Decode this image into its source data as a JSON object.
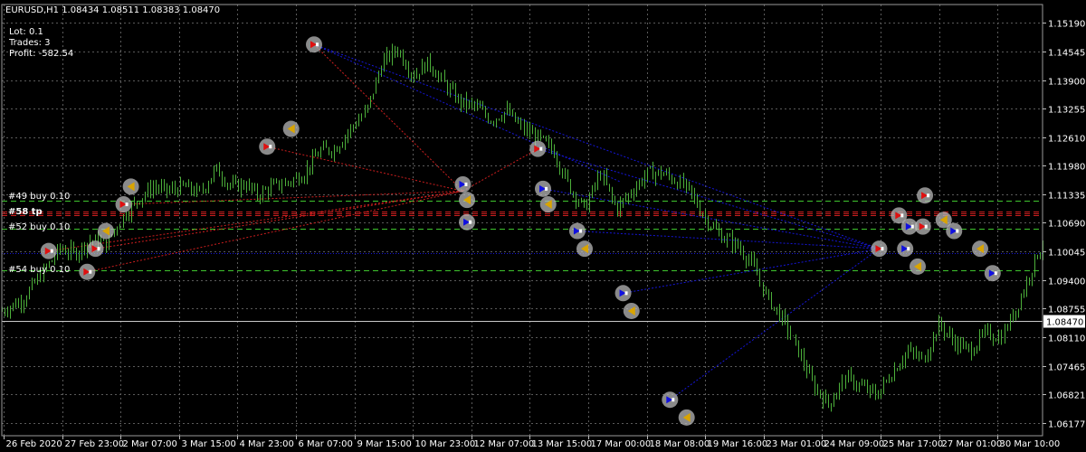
{
  "header": {
    "symbol_line": "EURUSD,H1  1.08434 1.08511 1.08383 1.08470",
    "lot": "Lot: 0.1",
    "trades": "Trades: 3",
    "profit": "Profit: -582.54"
  },
  "current_price": {
    "value": 1.0847,
    "label": "1.08470"
  },
  "colors": {
    "background": "#000000",
    "grid": "#5a5a5a",
    "candle": "#4caf3a",
    "level_green": "#3ec42e",
    "level_red": "#d62020",
    "blue_line": "#1515d8",
    "red_line": "#cc1e1e",
    "price_line": "#c8c8c8"
  },
  "chart_data": {
    "type": "candlestick",
    "title": "EURUSD,H1",
    "ylim": [
      1.0589,
      1.156
    ],
    "y_ticks": [
      {
        "v": 1.1519,
        "label": "1.15190"
      },
      {
        "v": 1.14545,
        "label": "1.14545"
      },
      {
        "v": 1.139,
        "label": "1.13900"
      },
      {
        "v": 1.13255,
        "label": "1.13255"
      },
      {
        "v": 1.1261,
        "label": "1.12610"
      },
      {
        "v": 1.1198,
        "label": "1.11980"
      },
      {
        "v": 1.11335,
        "label": "1.11335"
      },
      {
        "v": 1.1069,
        "label": "1.10690"
      },
      {
        "v": 1.10045,
        "label": "1.10045"
      },
      {
        "v": 1.094,
        "label": "1.09400"
      },
      {
        "v": 1.08755,
        "label": "1.08755"
      },
      {
        "v": 1.0811,
        "label": "1.08110"
      },
      {
        "v": 1.07465,
        "label": "1.07465"
      },
      {
        "v": 1.06821,
        "label": "1.06821"
      },
      {
        "v": 1.06177,
        "label": "1.06177"
      }
    ],
    "x_ticks": [
      "26 Feb 2020",
      "27 Feb 23:00",
      "2 Mar 07:00",
      "3 Mar 15:00",
      "4 Mar 23:00",
      "6 Mar 07:00",
      "9 Mar 15:00",
      "10 Mar 23:00",
      "12 Mar 07:00",
      "13 Mar 15:00",
      "17 Mar 00:00",
      "18 Mar 08:00",
      "19 Mar 16:00",
      "23 Mar 01:00",
      "24 Mar 09:00",
      "25 Mar 17:00",
      "27 Mar 01:00",
      "30 Mar 10:00"
    ],
    "price_path": [
      [
        0,
        1.087
      ],
      [
        0.02,
        1.0895
      ],
      [
        0.04,
        1.096
      ],
      [
        0.055,
        1.101
      ],
      [
        0.07,
        1.1
      ],
      [
        0.085,
        1.103
      ],
      [
        0.1,
        1.102
      ],
      [
        0.115,
        1.108
      ],
      [
        0.13,
        1.112
      ],
      [
        0.145,
        1.115
      ],
      [
        0.16,
        1.114
      ],
      [
        0.175,
        1.115
      ],
      [
        0.19,
        1.1135
      ],
      [
        0.205,
        1.119
      ],
      [
        0.22,
        1.115
      ],
      [
        0.235,
        1.1155
      ],
      [
        0.245,
        1.113
      ],
      [
        0.26,
        1.115
      ],
      [
        0.275,
        1.116
      ],
      [
        0.29,
        1.118
      ],
      [
        0.305,
        1.123
      ],
      [
        0.32,
        1.1235
      ],
      [
        0.335,
        1.128
      ],
      [
        0.35,
        1.132
      ],
      [
        0.365,
        1.143
      ],
      [
        0.38,
        1.146
      ],
      [
        0.395,
        1.14
      ],
      [
        0.41,
        1.143
      ],
      [
        0.425,
        1.138
      ],
      [
        0.44,
        1.134
      ],
      [
        0.455,
        1.133
      ],
      [
        0.47,
        1.13
      ],
      [
        0.485,
        1.132
      ],
      [
        0.5,
        1.128
      ],
      [
        0.515,
        1.126
      ],
      [
        0.53,
        1.123
      ],
      [
        0.545,
        1.115
      ],
      [
        0.56,
        1.11
      ],
      [
        0.575,
        1.118
      ],
      [
        0.59,
        1.11
      ],
      [
        0.605,
        1.114
      ],
      [
        0.62,
        1.118
      ],
      [
        0.635,
        1.118
      ],
      [
        0.65,
        1.116
      ],
      [
        0.66,
        1.114
      ],
      [
        0.675,
        1.108
      ],
      [
        0.69,
        1.104
      ],
      [
        0.705,
        1.102
      ],
      [
        0.72,
        1.098
      ],
      [
        0.735,
        1.09
      ],
      [
        0.75,
        1.085
      ],
      [
        0.765,
        1.078
      ],
      [
        0.78,
        1.07
      ],
      [
        0.795,
        1.066
      ],
      [
        0.81,
        1.072
      ],
      [
        0.825,
        1.07
      ],
      [
        0.84,
        1.068
      ],
      [
        0.855,
        1.073
      ],
      [
        0.87,
        1.078
      ],
      [
        0.885,
        1.076
      ],
      [
        0.9,
        1.084
      ],
      [
        0.915,
        1.08
      ],
      [
        0.93,
        1.078
      ],
      [
        0.945,
        1.082
      ],
      [
        0.96,
        1.081
      ],
      [
        0.975,
        1.088
      ],
      [
        0.985,
        1.094
      ],
      [
        0.995,
        1.1
      ],
      [
        1.0,
        1.102
      ]
    ],
    "levels": [
      {
        "price": 1.1119,
        "color": "green",
        "label": "#49 buy 0.10"
      },
      {
        "price": 1.1094,
        "color": "red",
        "label": ""
      },
      {
        "price": 1.109,
        "color": "red",
        "label": "#58 tp"
      },
      {
        "price": 1.1086,
        "color": "red",
        "label": ""
      },
      {
        "price": 1.1056,
        "color": "green",
        "label": "#52 buy 0.10"
      },
      {
        "price": 1.1,
        "color": "blue",
        "label": ""
      },
      {
        "price": 1.0962,
        "color": "green",
        "label": "#54 buy 0.10"
      }
    ],
    "markers": [
      {
        "x": 0.045,
        "y": 1.1005,
        "c": "red"
      },
      {
        "x": 0.09,
        "y": 1.101,
        "c": "red"
      },
      {
        "x": 0.082,
        "y": 1.0958,
        "c": "red"
      },
      {
        "x": 0.1,
        "y": 1.105,
        "c": "gold"
      },
      {
        "x": 0.117,
        "y": 1.111,
        "c": "red"
      },
      {
        "x": 0.124,
        "y": 1.115,
        "c": "gold"
      },
      {
        "x": 0.255,
        "y": 1.124,
        "c": "red"
      },
      {
        "x": 0.278,
        "y": 1.128,
        "c": "gold"
      },
      {
        "x": 0.3,
        "y": 1.147,
        "c": "red"
      },
      {
        "x": 0.443,
        "y": 1.1155,
        "c": "blue"
      },
      {
        "x": 0.447,
        "y": 1.112,
        "c": "gold"
      },
      {
        "x": 0.447,
        "y": 1.107,
        "c": "blue"
      },
      {
        "x": 0.515,
        "y": 1.1235,
        "c": "red"
      },
      {
        "x": 0.52,
        "y": 1.1145,
        "c": "blue"
      },
      {
        "x": 0.525,
        "y": 1.111,
        "c": "gold"
      },
      {
        "x": 0.553,
        "y": 1.105,
        "c": "blue"
      },
      {
        "x": 0.56,
        "y": 1.101,
        "c": "gold"
      },
      {
        "x": 0.597,
        "y": 1.091,
        "c": "blue"
      },
      {
        "x": 0.605,
        "y": 1.087,
        "c": "gold"
      },
      {
        "x": 0.642,
        "y": 1.067,
        "c": "blue"
      },
      {
        "x": 0.658,
        "y": 1.063,
        "c": "gold"
      },
      {
        "x": 0.843,
        "y": 1.101,
        "c": "red"
      },
      {
        "x": 0.862,
        "y": 1.1085,
        "c": "red"
      },
      {
        "x": 0.868,
        "y": 1.101,
        "c": "blue"
      },
      {
        "x": 0.872,
        "y": 1.106,
        "c": "blue"
      },
      {
        "x": 0.88,
        "y": 1.097,
        "c": "gold"
      },
      {
        "x": 0.885,
        "y": 1.106,
        "c": "red"
      },
      {
        "x": 0.887,
        "y": 1.113,
        "c": "red"
      },
      {
        "x": 0.905,
        "y": 1.1075,
        "c": "gold"
      },
      {
        "x": 0.915,
        "y": 1.105,
        "c": "blue"
      },
      {
        "x": 0.94,
        "y": 1.101,
        "c": "gold"
      },
      {
        "x": 0.952,
        "y": 1.0955,
        "c": "blue"
      }
    ],
    "red_lines": [
      [
        0.045,
        1.1005,
        0.443,
        1.114
      ],
      [
        0.09,
        1.101,
        0.443,
        1.114
      ],
      [
        0.082,
        1.0958,
        0.443,
        1.114
      ],
      [
        0.117,
        1.111,
        0.443,
        1.114
      ],
      [
        0.255,
        1.124,
        0.443,
        1.114
      ],
      [
        0.3,
        1.147,
        0.443,
        1.114
      ],
      [
        0.443,
        1.114,
        0.515,
        1.1235
      ]
    ],
    "blue_lines": [
      [
        0.3,
        1.147,
        0.843,
        1.101
      ],
      [
        0.515,
        1.1235,
        0.843,
        1.101
      ],
      [
        0.52,
        1.1145,
        0.843,
        1.101
      ],
      [
        0.553,
        1.105,
        0.843,
        1.101
      ],
      [
        0.597,
        1.091,
        0.843,
        1.101
      ],
      [
        0.642,
        1.067,
        0.843,
        1.101
      ],
      [
        0.3,
        1.147,
        0.595,
        1.116
      ]
    ],
    "level_labels": {
      "l49": "#49 buy 0.10",
      "l58": "#58 tp",
      "l52": "#52 buy 0.10",
      "l54": "#54 buy 0.10"
    }
  }
}
